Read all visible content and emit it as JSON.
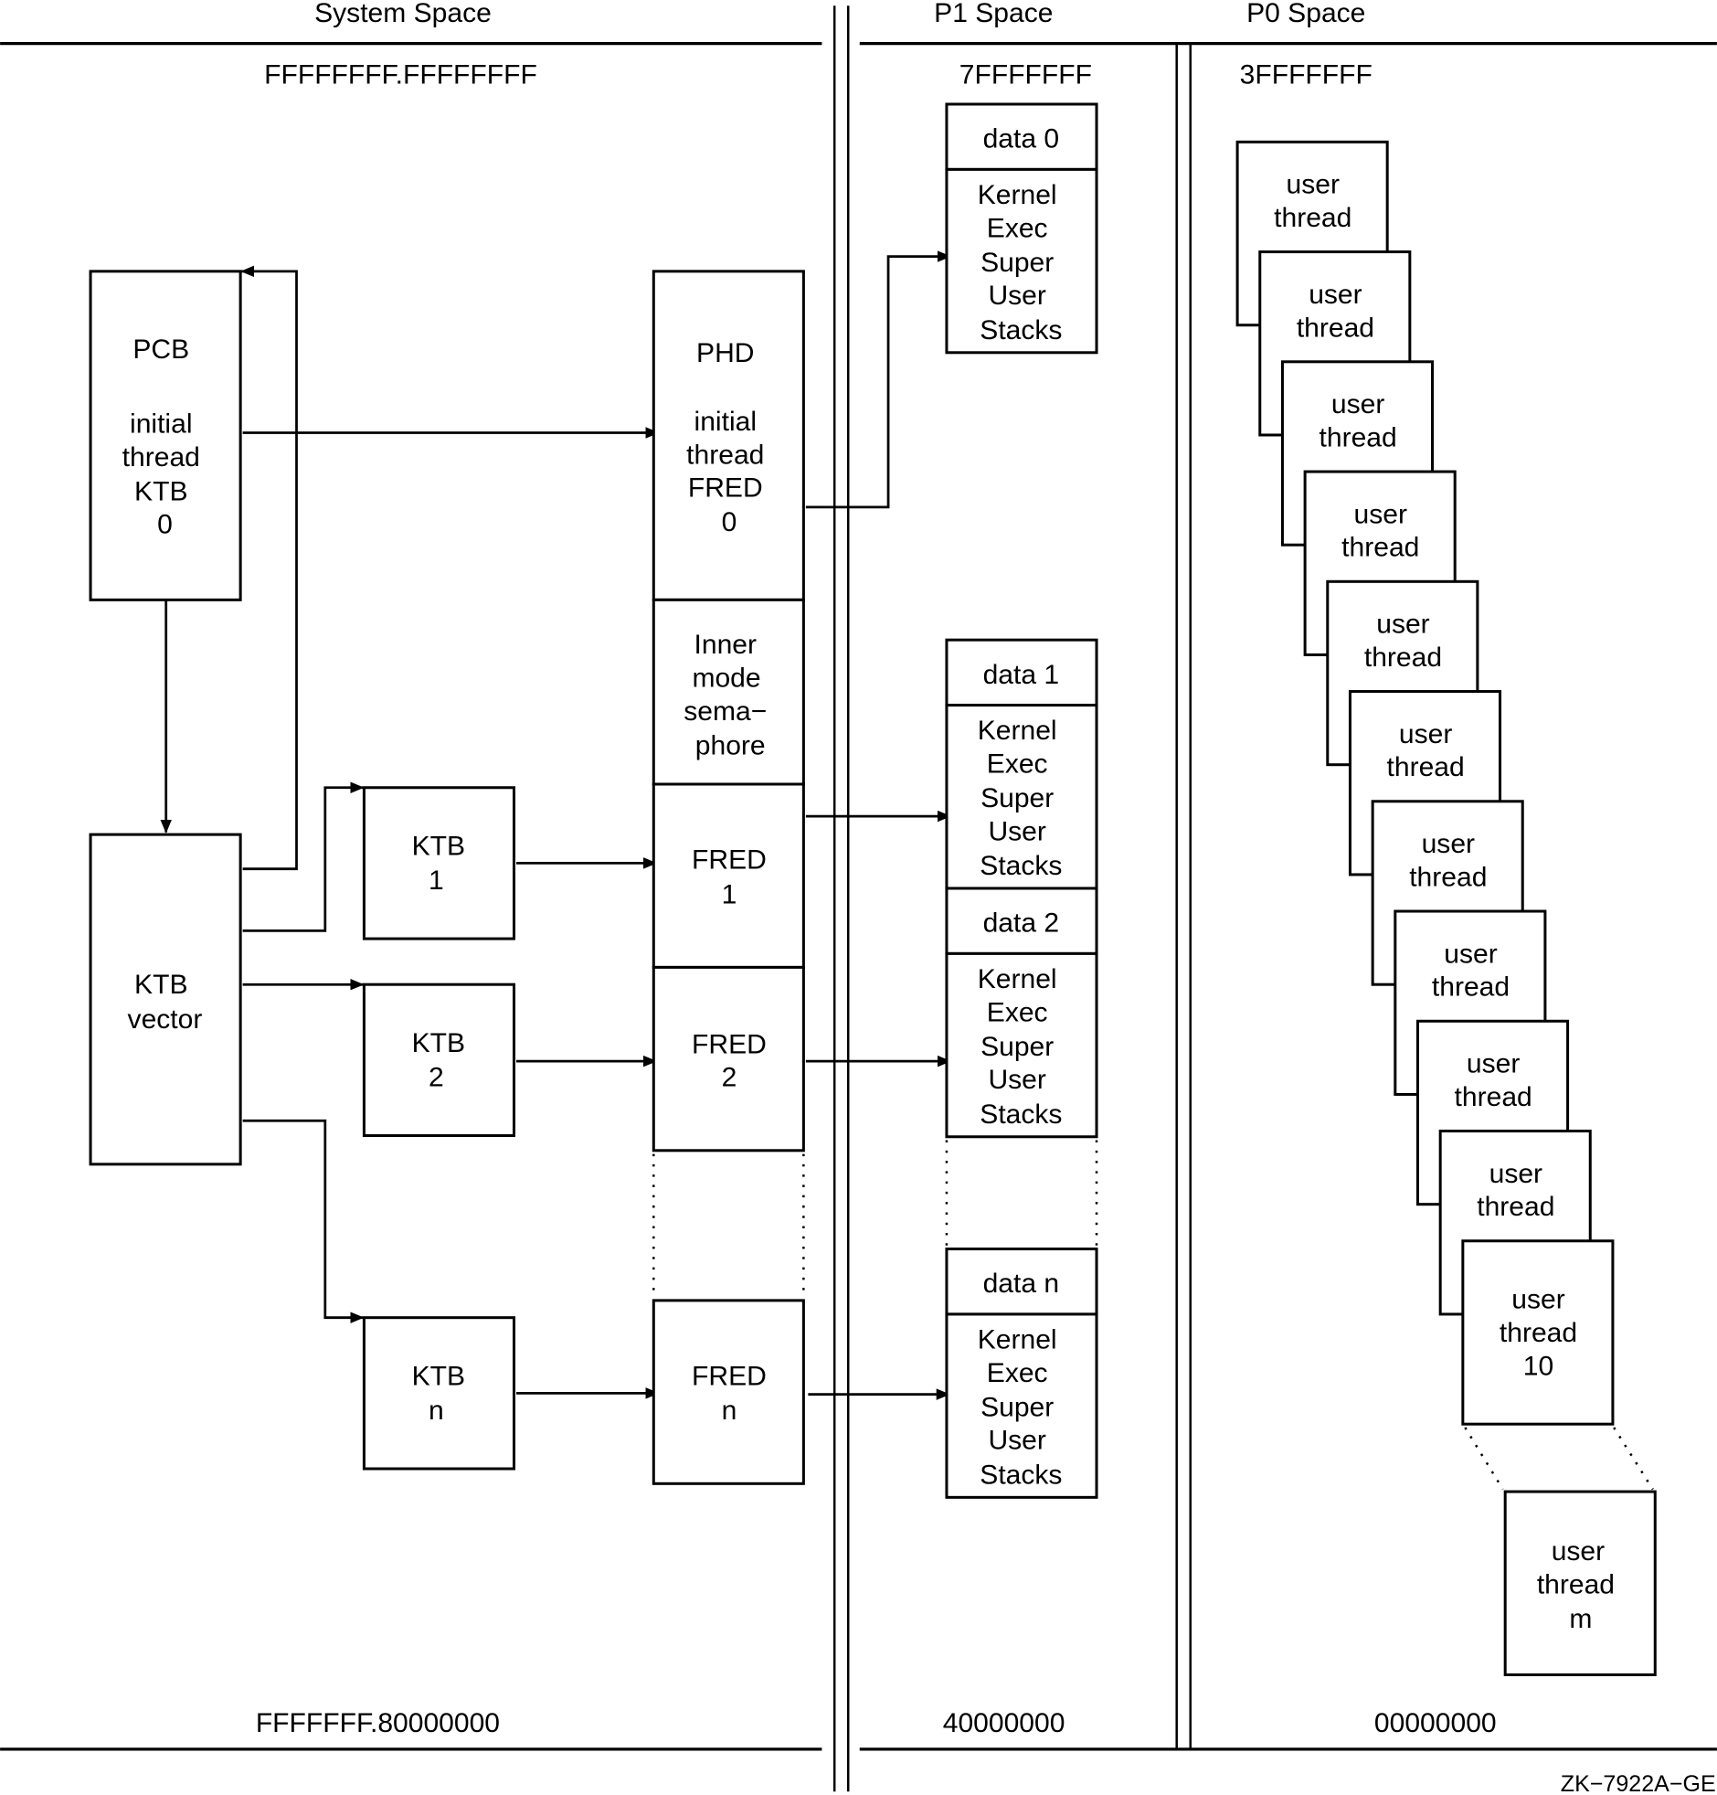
{
  "regions": {
    "system_space": {
      "title": "System Space",
      "addr_top": "FFFFFFFF.FFFFFFFF",
      "addr_bottom": "FFFFFFF.80000000"
    },
    "p1_space": {
      "title": "P1 Space",
      "addr_top": "7FFFFFFF",
      "addr_bottom": "40000000"
    },
    "p0_space": {
      "title": "P0 Space",
      "addr_top": "3FFFFFFF",
      "addr_bottom": "00000000"
    }
  },
  "pcb": {
    "lines": [
      "PCB",
      "",
      "initial",
      "thread",
      "KTB",
      "0"
    ]
  },
  "ktb_vector": {
    "lines": [
      "KTB",
      "vector"
    ]
  },
  "ktbs": [
    {
      "lines": [
        "KTB",
        "1"
      ]
    },
    {
      "lines": [
        "KTB",
        "2"
      ]
    },
    {
      "lines": [
        "KTB",
        "n"
      ]
    }
  ],
  "phd_column": {
    "phd": {
      "lines": [
        "PHD",
        "",
        "initial",
        "thread",
        "FRED",
        "0"
      ]
    },
    "inner_mode": {
      "lines": [
        "Inner",
        "mode",
        "sema−",
        "phore"
      ]
    },
    "freds": [
      {
        "lines": [
          "FRED",
          "1"
        ]
      },
      {
        "lines": [
          "FRED",
          "2"
        ]
      },
      {
        "lines": [
          "FRED",
          "n"
        ]
      }
    ]
  },
  "p1_blocks": [
    {
      "data": "data 0",
      "stacks": [
        "Kernel",
        "Exec",
        "Super",
        "User",
        "Stacks"
      ]
    },
    {
      "data": "data 1",
      "stacks": [
        "Kernel",
        "Exec",
        "Super",
        "User",
        "Stacks"
      ]
    },
    {
      "data": "data 2",
      "stacks": [
        "Kernel",
        "Exec",
        "Super",
        "User",
        "Stacks"
      ]
    },
    {
      "data": "data n",
      "stacks": [
        "Kernel",
        "Exec",
        "Super",
        "User",
        "Stacks"
      ]
    }
  ],
  "user_threads": [
    {
      "lines": [
        "user",
        "thread"
      ]
    },
    {
      "lines": [
        "user",
        "thread"
      ]
    },
    {
      "lines": [
        "user",
        "thread"
      ]
    },
    {
      "lines": [
        "user",
        "thread"
      ]
    },
    {
      "lines": [
        "user",
        "thread"
      ]
    },
    {
      "lines": [
        "user",
        "thread"
      ]
    },
    {
      "lines": [
        "user",
        "thread"
      ]
    },
    {
      "lines": [
        "user",
        "thread"
      ]
    },
    {
      "lines": [
        "user",
        "thread"
      ]
    },
    {
      "lines": [
        "user",
        "thread"
      ]
    },
    {
      "lines": [
        "user",
        "thread",
        "10"
      ]
    }
  ],
  "user_thread_m": {
    "lines": [
      "user",
      "thread",
      "m"
    ]
  },
  "figure_id": "ZK−7922A−GE"
}
